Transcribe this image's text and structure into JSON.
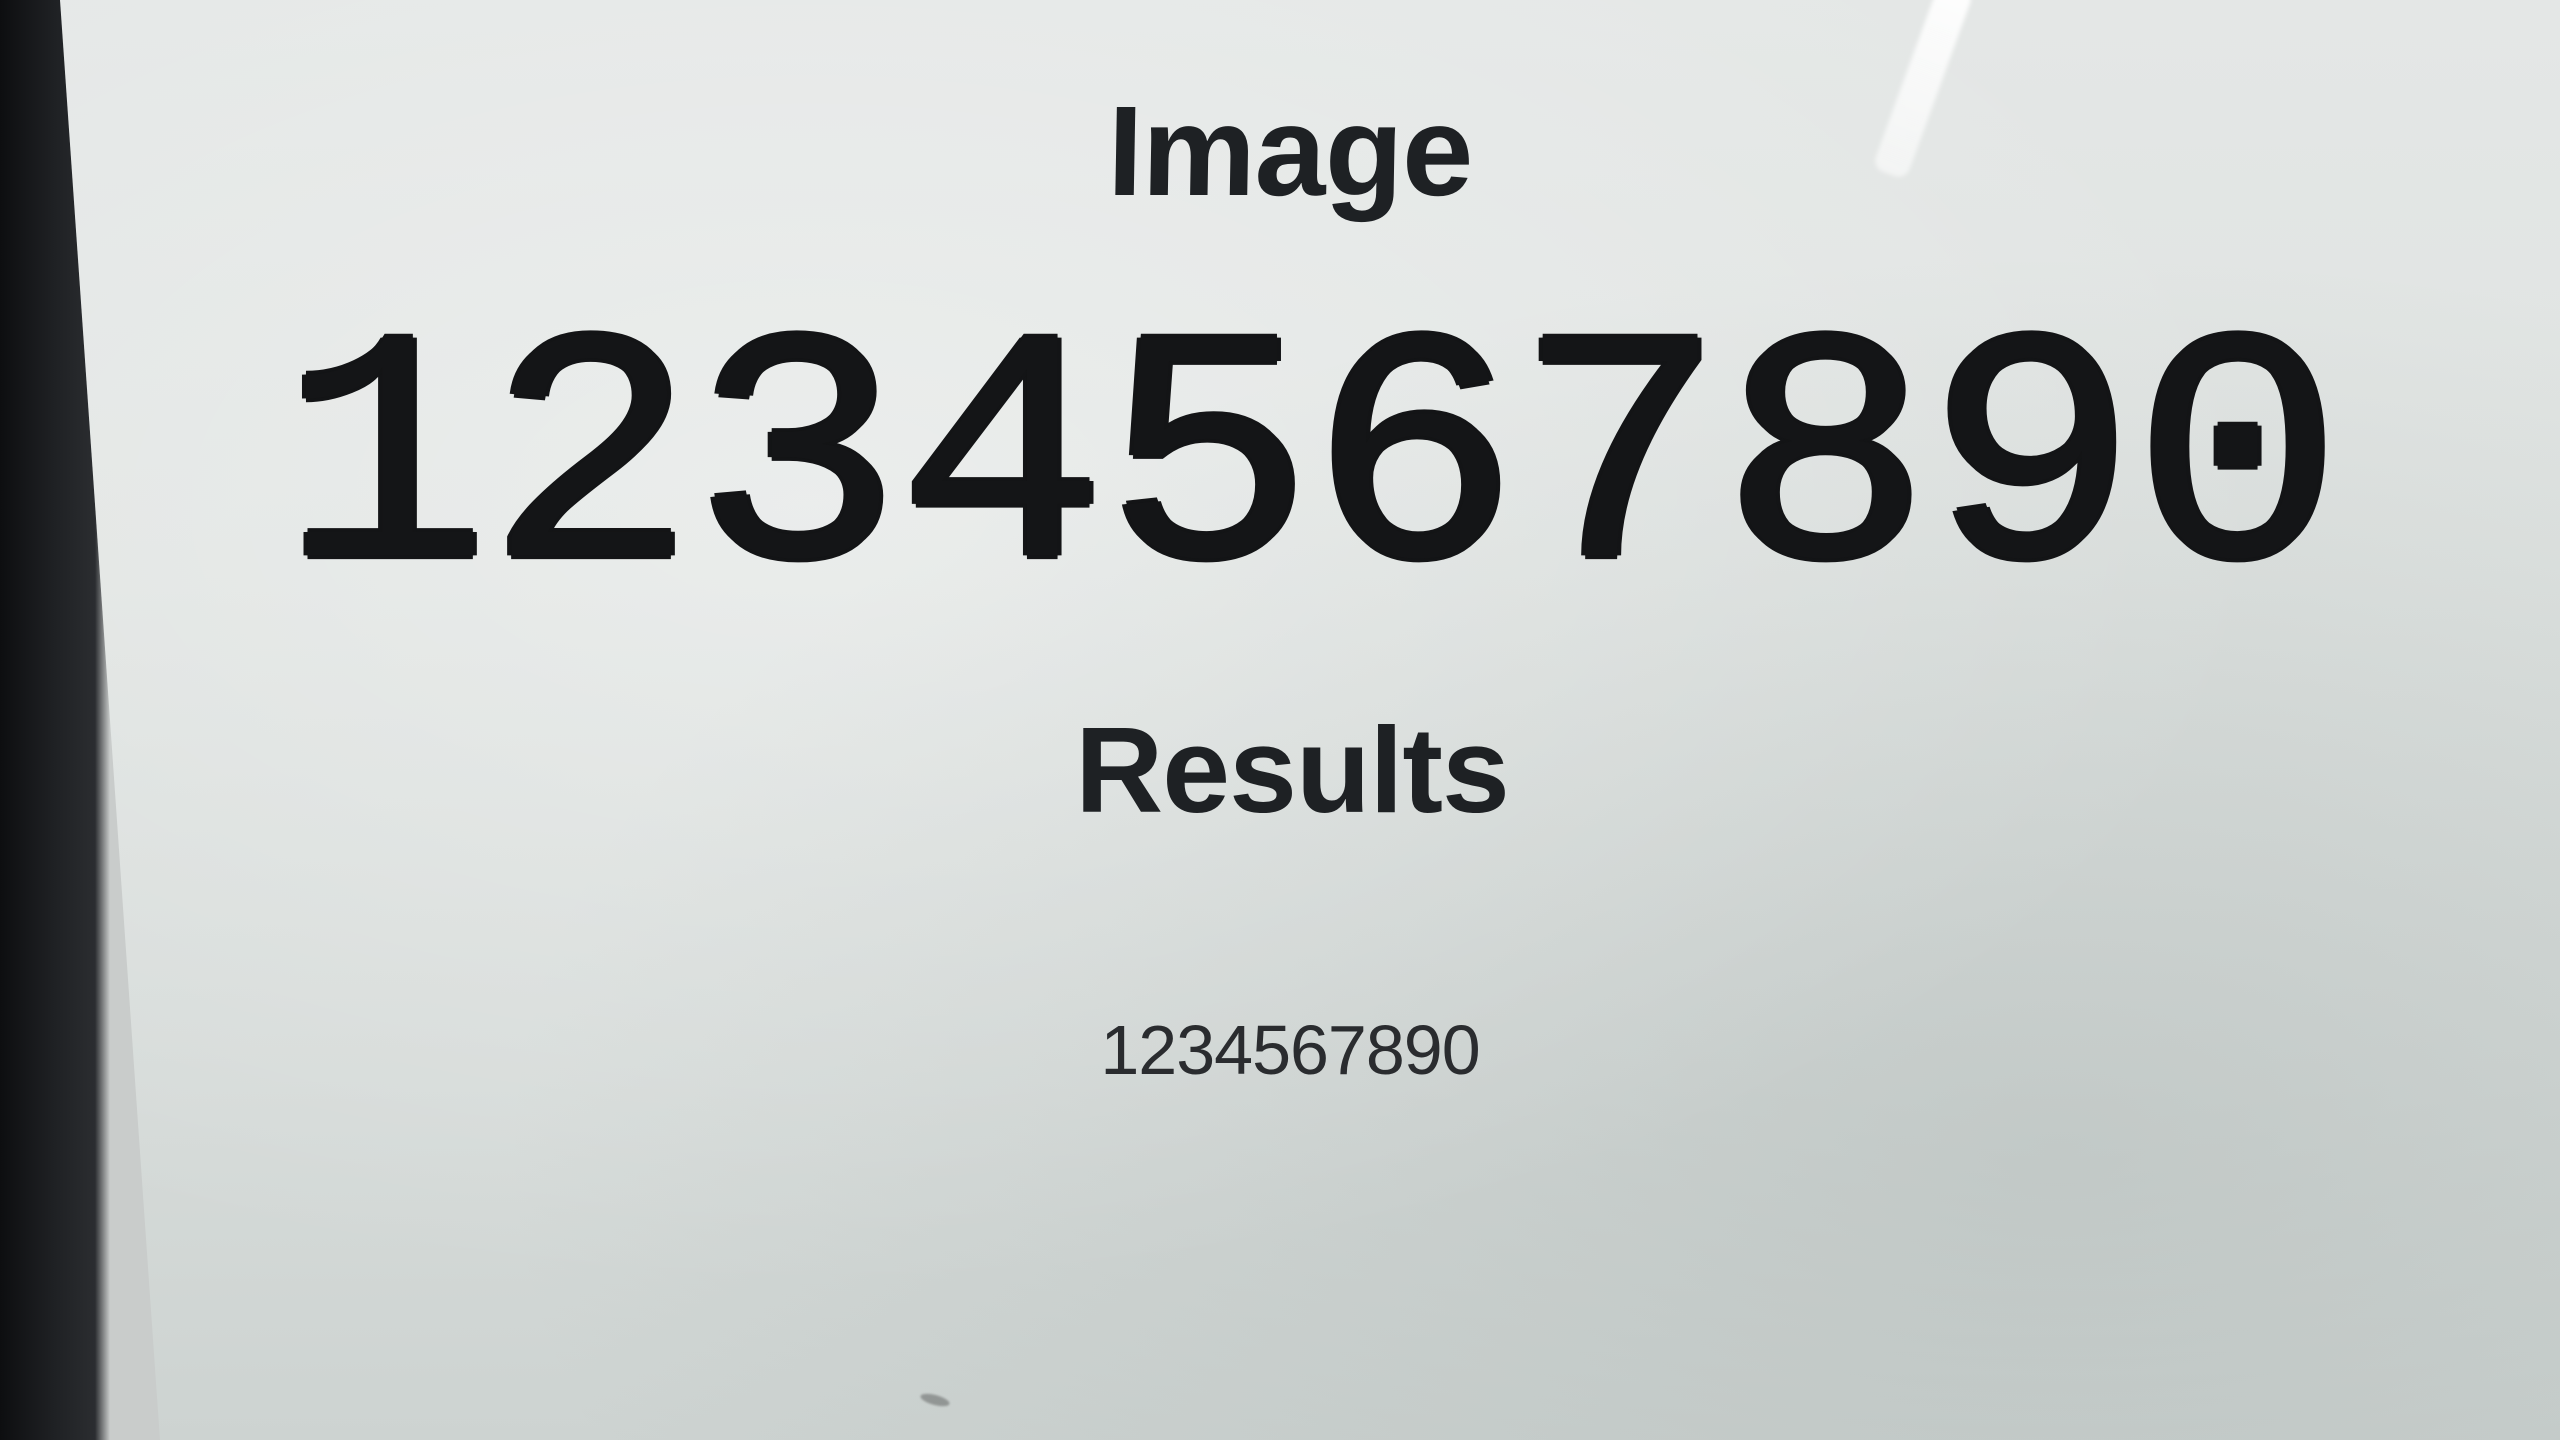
{
  "page": {
    "image_heading": "Image",
    "image_number": "1234567890",
    "results_heading": "Results",
    "results_value": "1234567890"
  }
}
